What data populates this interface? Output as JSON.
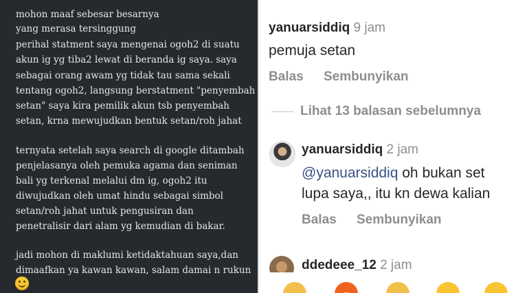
{
  "note": {
    "lines": [
      "mohon maaf sebesar besarnya",
      "yang merasa tersinggung",
      "perihal statment saya mengenai ogoh2 di suatu",
      "akun ig yg tiba2 lewat di beranda ig saya. saya",
      "sebagai orang awam yg tidak tau sama sekali",
      "tentang ogoh2, langsung berstatment \"penyembah",
      "setan\" saya kira pemilik akun tsb penyembah",
      "setan, krna mewujudkan bentuk setan/roh jahat",
      "ternyata setelah saya search di google ditambah",
      "penjelasanya oleh pemuka agama dan seniman",
      "bali yg terkenal melalui dm ig, ogoh2 itu",
      "diwujudkan oleh umat hindu sebagai simbol",
      "setan/roh jahat untuk pengusiran dan",
      "penetralisir dari alam yg kemudian di bakar.",
      "jadi mohon di maklumi ketidaktahuan saya,dan",
      "dimaafkan ya kawan kawan, salam damai n rukun"
    ],
    "emoji_icon": "smiling-face-icon"
  },
  "comments": {
    "first": {
      "username": "yanuarsiddiq",
      "time": "9 jam",
      "text": "pemuja setan",
      "reply_label": "Balas",
      "hide_label": "Sembunyikan"
    },
    "view_replies_label": "Lihat 13 balasan sebelumnya",
    "second": {
      "username": "yanuarsiddiq",
      "time": "2 jam",
      "mention": "@yanuarsiddiq",
      "text_line1": "oh bukan set",
      "text_line2": "lupa saya,, itu kn dewa kalian",
      "reply_label": "Balas",
      "hide_label": "Sembunyikan"
    },
    "third": {
      "username": "ddedeee_12",
      "time": "2 jam"
    }
  },
  "emoji_bar": [
    "clapping-hands-icon",
    "fire-icon",
    "raising-hands-icon",
    "smiling-face-icon",
    "heart-eyes-icon"
  ],
  "colors": {
    "dark_bg": "#262a2e",
    "mention": "#385185",
    "muted": "#8e8e8e"
  }
}
